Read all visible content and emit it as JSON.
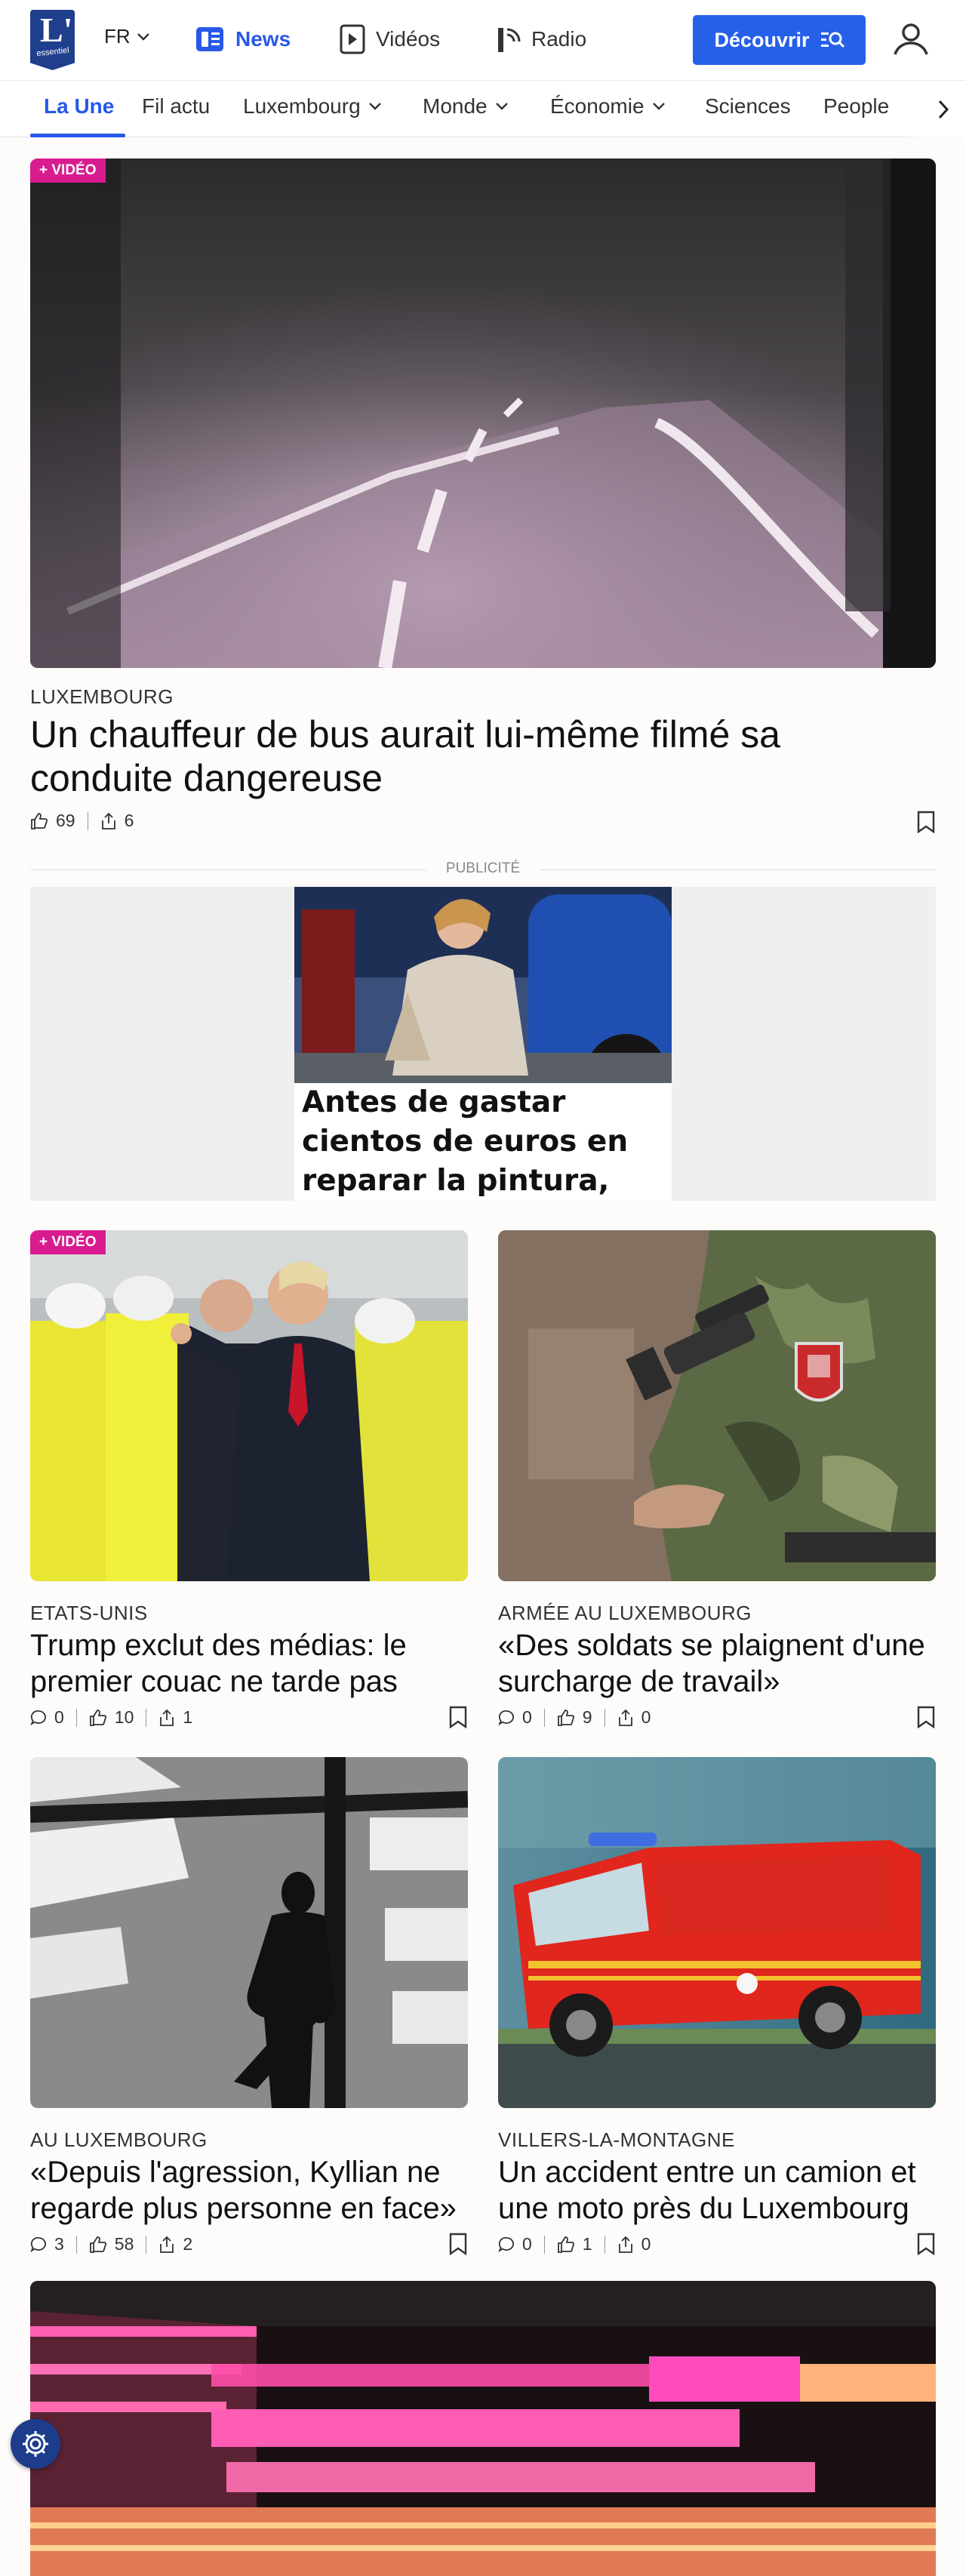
{
  "header": {
    "logo_text": "L'",
    "logo_sub": "essentiel",
    "language": "FR",
    "nav": [
      {
        "label": "News",
        "icon": "news-icon",
        "active": true
      },
      {
        "label": "Vidéos",
        "icon": "play-icon",
        "active": false
      },
      {
        "label": "Radio",
        "icon": "radio-icon",
        "active": false
      }
    ],
    "discover_label": "Découvrir",
    "accent": "#2660e8"
  },
  "tabs": [
    {
      "label": "La Une",
      "active": true
    },
    {
      "label": "Fil actu"
    },
    {
      "label": "Luxembourg",
      "dropdown": true
    },
    {
      "label": "Monde",
      "dropdown": true
    },
    {
      "label": "Économie",
      "dropdown": true
    },
    {
      "label": "Sciences"
    },
    {
      "label": "People"
    }
  ],
  "hero": {
    "badge": "+ VIDÉO",
    "kicker": "LUXEMBOURG",
    "title": "Un chauffeur de bus aurait lui-même filmé sa conduite dangereuse",
    "likes": "69",
    "shares": "6"
  },
  "ad": {
    "label": "PUBLICITÉ",
    "text": "Antes de gastar cientos de euros en reparar la pintura, prueba esto"
  },
  "articles": [
    {
      "badge": "+ VIDÉO",
      "kicker": "ETATS-UNIS",
      "title": "Trump exclut des médias: le premier couac ne tarde pas",
      "comments": "0",
      "likes": "10",
      "shares": "1"
    },
    {
      "badge": "",
      "kicker": "ARMÉE AU LUXEMBOURG",
      "title": "«Des soldats se plaignent d'une surcharge de travail»",
      "comments": "0",
      "likes": "9",
      "shares": "0"
    },
    {
      "badge": "",
      "kicker": "AU LUXEMBOURG",
      "title": "«Depuis l'agression, Kyllian ne regarde plus personne en face»",
      "comments": "3",
      "likes": "58",
      "shares": "2"
    },
    {
      "badge": "",
      "kicker": "VILLERS-LA-MONTAGNE",
      "title": "Un accident entre un camion et une moto près du Luxembourg",
      "comments": "0",
      "likes": "1",
      "shares": "0"
    }
  ],
  "badge_color": "#d81b8f"
}
